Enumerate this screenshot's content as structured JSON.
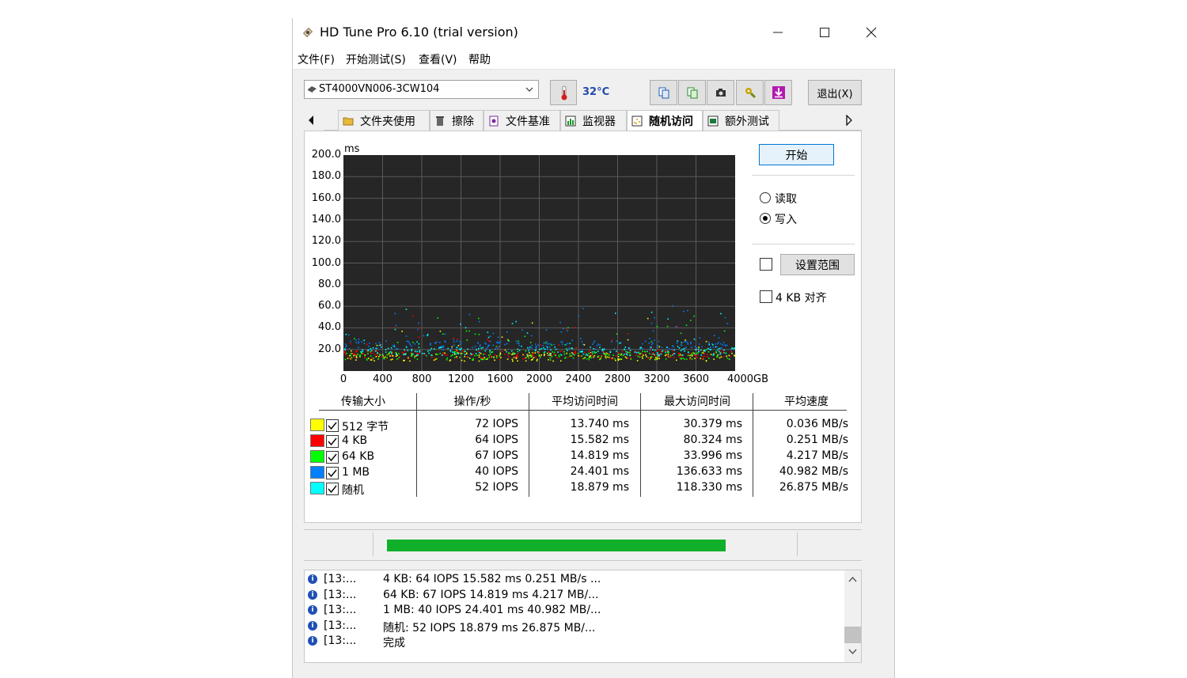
{
  "window": {
    "title": "HD Tune Pro 6.10 (trial version)"
  },
  "menu": [
    "文件(F)",
    "开始测试(S)",
    "查看(V)",
    "帮助"
  ],
  "toolbar": {
    "drive": "ST4000VN006-3CW104",
    "temperature": "32°C",
    "exit_label": "退出(X)"
  },
  "tabs": [
    {
      "label": "文件夹使用",
      "icon": "folder-icon"
    },
    {
      "label": "擦除",
      "icon": "trash-icon"
    },
    {
      "label": "文件基准",
      "icon": "file-benchmark-icon"
    },
    {
      "label": "监视器",
      "icon": "monitor-chart-icon"
    },
    {
      "label": "随机访问",
      "icon": "random-access-icon",
      "active": true
    },
    {
      "label": "额外测试",
      "icon": "extra-tests-icon"
    }
  ],
  "chart_data": {
    "type": "scatter",
    "ylabel": "ms",
    "ylim": [
      0,
      200
    ],
    "xlim": [
      0,
      4000
    ],
    "yticks": [
      "200.0",
      "180.0",
      "160.0",
      "140.0",
      "120.0",
      "100.0",
      "80.0",
      "60.0",
      "40.0",
      "20.0"
    ],
    "xticks": [
      "0",
      "400",
      "800",
      "1200",
      "1600",
      "2000",
      "2400",
      "2800",
      "3200",
      "3600",
      "4000GB"
    ],
    "series": [
      {
        "name": "512 字节",
        "color": "#ffff00",
        "typical_ms": 13.74
      },
      {
        "name": "4 KB",
        "color": "#ff0000",
        "typical_ms": 15.582
      },
      {
        "name": "64 KB",
        "color": "#00ff00",
        "typical_ms": 14.819
      },
      {
        "name": "1 MB",
        "color": "#0080ff",
        "typical_ms": 24.401
      },
      {
        "name": "随机",
        "color": "#00ffff",
        "typical_ms": 18.879
      }
    ]
  },
  "controls": {
    "start_label": "开始",
    "read_label": "读取",
    "write_label": "写入",
    "mode": "write",
    "range_label": "设置范围",
    "align_label": "4 KB 对齐"
  },
  "results": {
    "headers": [
      "传输大小",
      "操作/秒",
      "平均访问时间",
      "最大访问时间",
      "平均速度"
    ],
    "rows": [
      {
        "size": "512 字节",
        "color": "#ffff00",
        "ops": "72 IOPS",
        "avg": "13.740 ms",
        "max": "30.379 ms",
        "speed": "0.036 MB/s"
      },
      {
        "size": "4 KB",
        "color": "#ff0000",
        "ops": "64 IOPS",
        "avg": "15.582 ms",
        "max": "80.324 ms",
        "speed": "0.251 MB/s"
      },
      {
        "size": "64 KB",
        "color": "#00ff00",
        "ops": "67 IOPS",
        "avg": "14.819 ms",
        "max": "33.996 ms",
        "speed": "4.217 MB/s"
      },
      {
        "size": "1 MB",
        "color": "#0080ff",
        "ops": "40 IOPS",
        "avg": "24.401 ms",
        "max": "136.633 ms",
        "speed": "40.982 MB/s"
      },
      {
        "size": "随机",
        "color": "#00ffff",
        "ops": "52 IOPS",
        "avg": "18.879 ms",
        "max": "118.330 ms",
        "speed": "26.875 MB/s"
      }
    ]
  },
  "progress": {
    "fraction": 1.0,
    "color": "#10b02a"
  },
  "log": [
    {
      "time": "[13:...",
      "text": "4 KB: 64 IOPS 15.582 ms 0.251 MB/s ..."
    },
    {
      "time": "[13:...",
      "text": "64 KB: 67 IOPS 14.819 ms 4.217 MB/..."
    },
    {
      "time": "[13:...",
      "text": "1 MB: 40 IOPS 24.401 ms 40.982 MB/..."
    },
    {
      "time": "[13:...",
      "text": "随机: 52 IOPS 18.879 ms 26.875 MB/..."
    },
    {
      "time": "[13:...",
      "text": "完成"
    }
  ]
}
